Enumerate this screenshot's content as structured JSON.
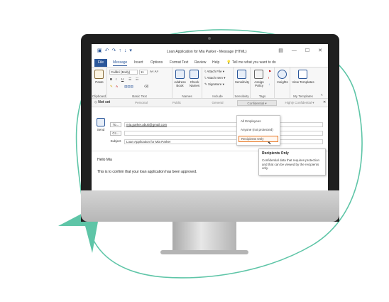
{
  "window": {
    "title": "Loan Application for Mia Parker - Message (HTML)",
    "minimize_glyph": "—",
    "restore_glyph": "☐",
    "close_glyph": "✕"
  },
  "tabs": [
    "File",
    "Message",
    "Insert",
    "Options",
    "Format Text",
    "Review",
    "Help"
  ],
  "tell_me": "Tell me what you want to do",
  "ribbon": {
    "paste": "Paste",
    "font_name": "Calibri (Body)",
    "font_size": "11",
    "address_book": "Address Book",
    "check_names": "Check Names",
    "attach_file": "Attach File",
    "attach_item": "Attach Item",
    "signature": "Signature",
    "sensitivity": "Sensitivity",
    "assign_policy": "Assign Policy",
    "insights": "Insights",
    "view_templates": "View Templates",
    "groups": [
      "Clipboard",
      "Basic Text",
      "Names",
      "Include",
      "Sensitivity",
      "Tags",
      "My Templates"
    ]
  },
  "sensitivity_bar": {
    "current": "Not set",
    "options": [
      "Personal",
      "Public",
      "General",
      "Confidential",
      "Highly Confidential"
    ]
  },
  "compose": {
    "send": "Send",
    "to_label": "To...",
    "cc_label": "Cc...",
    "subject_label": "Subject",
    "to_value": "mia.parker.abuk@gmail.com",
    "subject_value": "Loan Application for Mia Parker",
    "greeting": "Hello Mia",
    "body": "This is to confirm that your loan application has been approved."
  },
  "dropdown": {
    "items": [
      "All Employees",
      "Anyone (not protected)",
      "Recipients Only"
    ],
    "highlighted": "Recipients Only"
  },
  "tooltip": {
    "title": "Recipients Only",
    "text": "Confidential data that requires protection and that can be viewed by the recipients only."
  },
  "colors": {
    "accent": "#2b579a",
    "highlight": "#e87722",
    "decor_green": "#5ec5a7"
  }
}
